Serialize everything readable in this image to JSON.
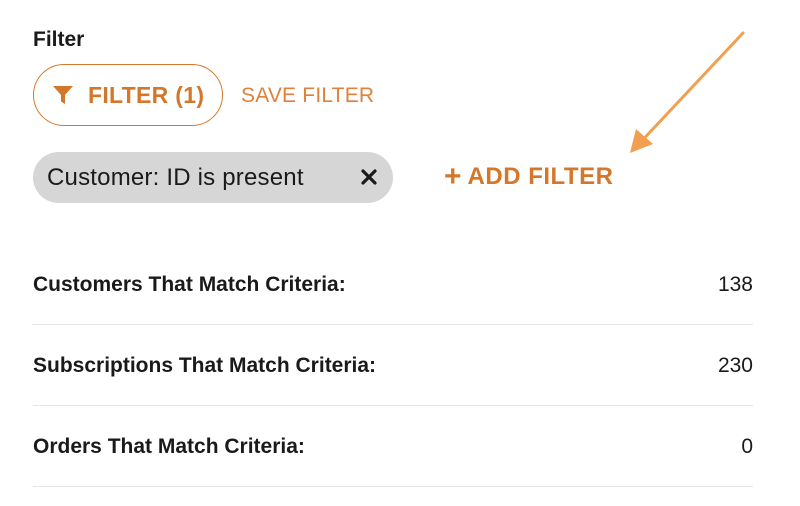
{
  "section": {
    "title": "Filter"
  },
  "filter_button": {
    "label": "FILTER (1)",
    "icon": "filter-funnel-icon"
  },
  "save_filter": {
    "label": "SAVE FILTER"
  },
  "active_filter": {
    "label": "Customer: ID is present",
    "close_icon": "close-icon"
  },
  "add_filter": {
    "plus": "+",
    "label": "ADD FILTER"
  },
  "stats": [
    {
      "label": "Customers That Match Criteria:",
      "value": "138"
    },
    {
      "label": "Subscriptions That Match Criteria:",
      "value": "230"
    },
    {
      "label": "Orders That Match Criteria:",
      "value": "0"
    }
  ],
  "colors": {
    "accent": "#d4772a",
    "accent_light": "#e0803a",
    "arrow": "#f0a050",
    "chip_bg": "#d6d6d6",
    "divider": "#e6e6e6"
  }
}
